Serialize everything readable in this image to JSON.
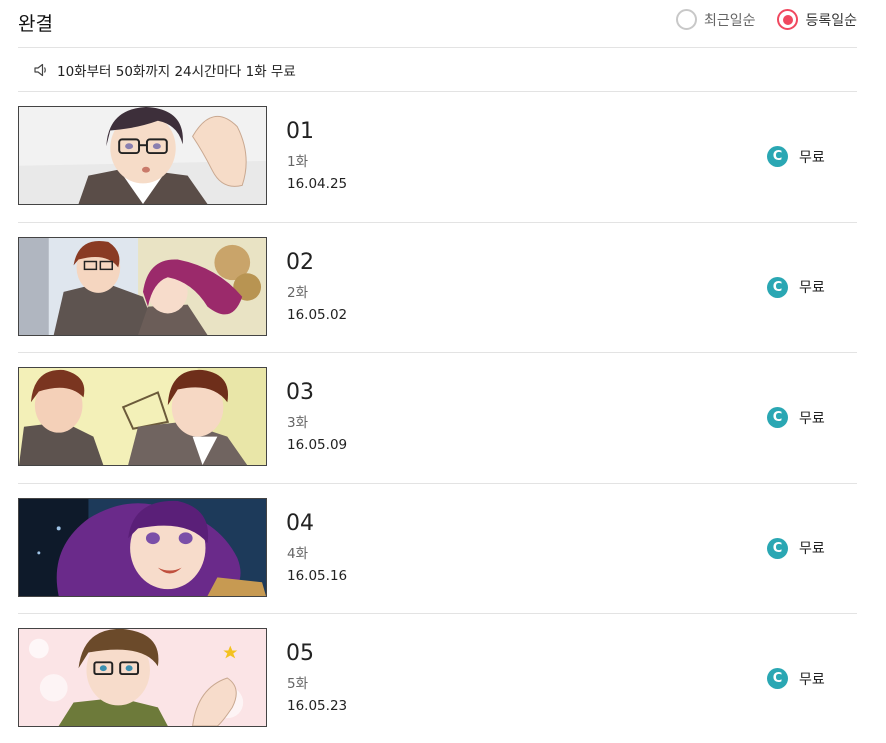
{
  "header": {
    "title": "완결",
    "sort_options": [
      {
        "label": "최근일순",
        "selected": false
      },
      {
        "label": "등록일순",
        "selected": true
      }
    ]
  },
  "notice": {
    "icon": "speaker-icon",
    "text": "10화부터 50화까지 24시간마다 1화 무료"
  },
  "episodes": [
    {
      "number": "01",
      "title": "1화",
      "date": "16.04.25",
      "price_label": "무료",
      "coin_symbol": "C"
    },
    {
      "number": "02",
      "title": "2화",
      "date": "16.05.02",
      "price_label": "무료",
      "coin_symbol": "C"
    },
    {
      "number": "03",
      "title": "3화",
      "date": "16.05.09",
      "price_label": "무료",
      "coin_symbol": "C"
    },
    {
      "number": "04",
      "title": "4화",
      "date": "16.05.16",
      "price_label": "무료",
      "coin_symbol": "C"
    },
    {
      "number": "05",
      "title": "5화",
      "date": "16.05.23",
      "price_label": "무료",
      "coin_symbol": "C"
    }
  ],
  "colors": {
    "accent": "#f0485f",
    "coin": "#2aa7b3",
    "divider": "#e3e3e3"
  }
}
